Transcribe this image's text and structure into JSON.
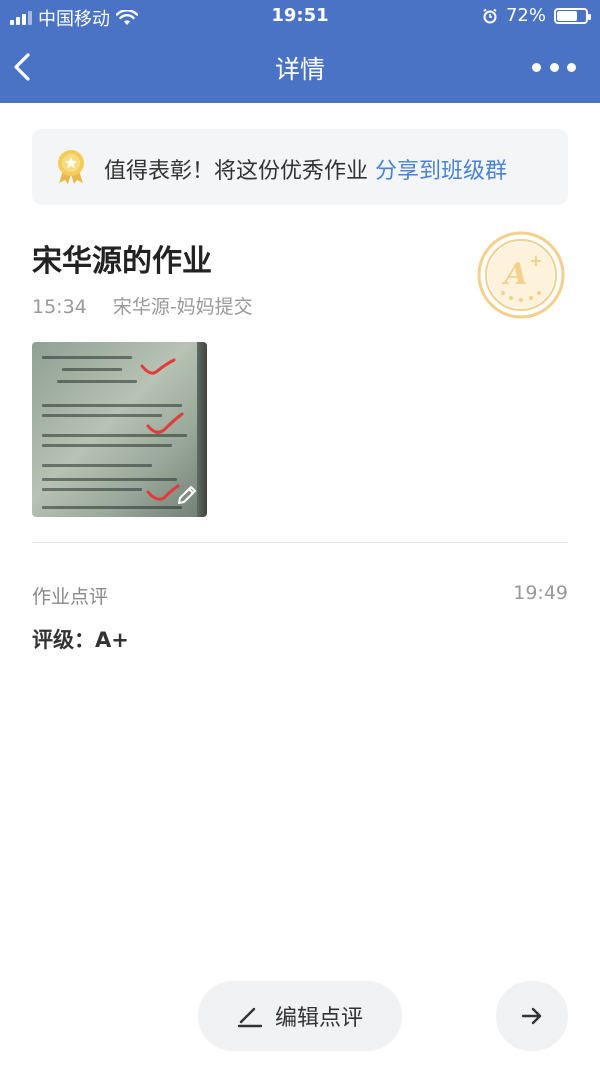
{
  "status_bar": {
    "carrier": "中国移动",
    "time": "19:51",
    "battery": "72%",
    "battery_level": 0.72
  },
  "nav": {
    "title": "详情"
  },
  "banner": {
    "text": "值得表彰！将这份优秀作业 ",
    "link": "分享到班级群"
  },
  "homework": {
    "title": "宋华源的作业",
    "submit_time": "15:34",
    "submitter": "宋华源-妈妈提交"
  },
  "comment": {
    "label": "作业点评",
    "time": "19:49",
    "grade_text": "评级：A+"
  },
  "actions": {
    "edit_label": "编辑点评"
  },
  "colors": {
    "header": "#4a73c6",
    "link": "#4a82d6",
    "stamp": "#f5cf8c"
  },
  "icons": {
    "back": "chevron-left-icon",
    "more": "more-dots-icon",
    "medal": "medal-icon",
    "stamp": "a-plus-stamp-icon",
    "pen": "pencil-icon",
    "edit": "edit-icon",
    "next": "arrow-right-icon"
  }
}
